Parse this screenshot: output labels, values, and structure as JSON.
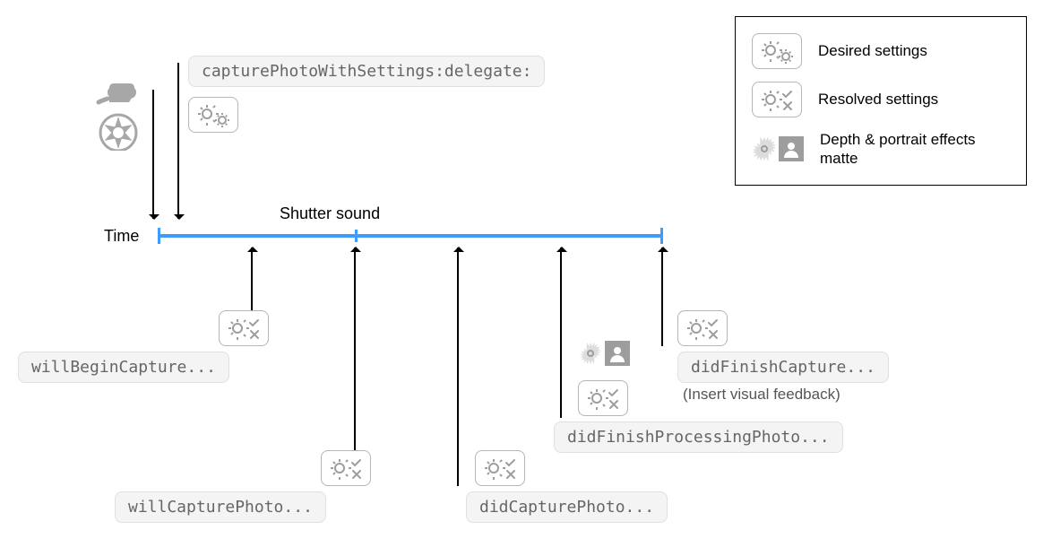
{
  "timeLabel": "Time",
  "shutterSoundLabel": "Shutter sound",
  "topMethod": "capturePhotoWithSettings:delegate:",
  "callbacks": {
    "willBegin": "willBeginCapture...",
    "willCapture": "willCapturePhoto...",
    "didCapture": "didCapturePhoto...",
    "didFinishProcessing": "didFinishProcessingPhoto...",
    "didFinishCapture": "didFinishCapture..."
  },
  "note": "(Insert visual feedback)",
  "legend": {
    "desired": "Desired settings",
    "resolved": "Resolved settings",
    "depth": "Depth & portrait effects matte"
  },
  "colors": {
    "timeline": "#3e9bff",
    "badgeBg": "#f4f4f4",
    "iconStroke": "#9d9d9d"
  }
}
